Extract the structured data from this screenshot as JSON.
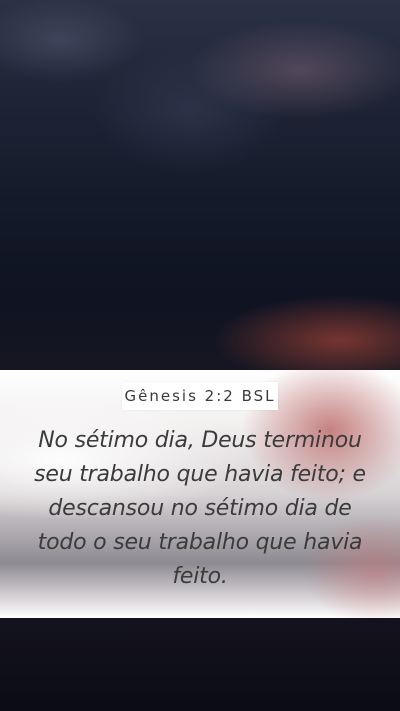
{
  "reference": "Gênesis 2:2 BSL",
  "verse": "No sétimo dia, Deus terminou seu trabalho que havia feito; e descansou no sétimo dia de todo o seu trabalho que havia feito."
}
